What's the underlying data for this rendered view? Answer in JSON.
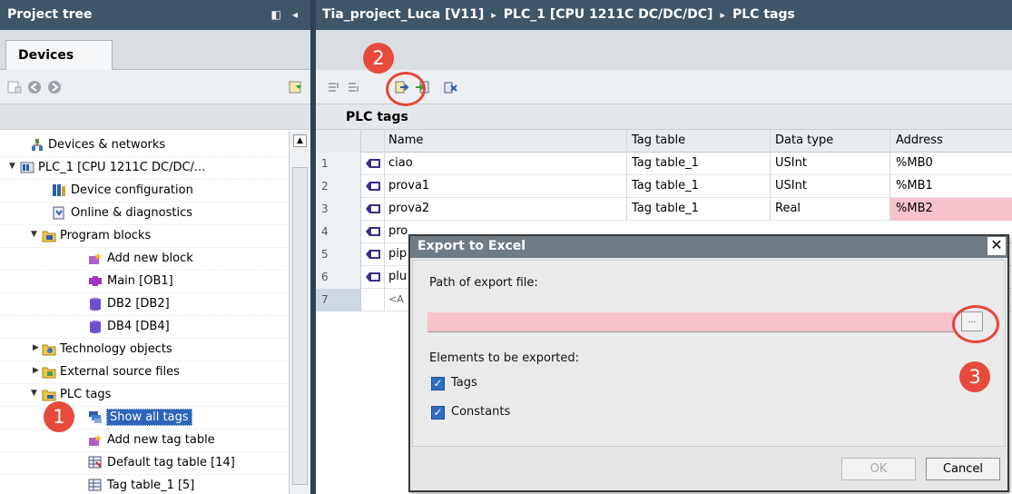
{
  "left": {
    "title": "Project tree",
    "window_controls": "◧ ◂",
    "devices_tab": "Devices"
  },
  "tree": {
    "items": [
      {
        "label": "Devices & networks"
      },
      {
        "label": "PLC_1 [CPU 1211C DC/DC/..."
      },
      {
        "label": "Device configuration"
      },
      {
        "label": "Online & diagnostics"
      },
      {
        "label": "Program blocks"
      },
      {
        "label": "Add new block"
      },
      {
        "label": "Main [OB1]"
      },
      {
        "label": "DB2 [DB2]"
      },
      {
        "label": "DB4 [DB4]"
      },
      {
        "label": "Technology objects"
      },
      {
        "label": "External source files"
      },
      {
        "label": "PLC tags"
      },
      {
        "label": "Show all tags"
      },
      {
        "label": "Add new tag table"
      },
      {
        "label": "Default tag table [14]"
      },
      {
        "label": "Tag table_1 [5]"
      }
    ]
  },
  "breadcrumb": {
    "project": "Tia_project_Luca [V11]",
    "device": "PLC_1 [CPU 1211C DC/DC/DC]",
    "section": "PLC tags",
    "separator": "▸"
  },
  "editor": {
    "title": "PLC tags",
    "columns": [
      "Name",
      "Tag table",
      "Data type",
      "Address"
    ],
    "rows": [
      {
        "n": "1",
        "name": "ciao",
        "table": "Tag table_1",
        "type": "USInt",
        "addr": "%MB0"
      },
      {
        "n": "2",
        "name": "prova1",
        "table": "Tag table_1",
        "type": "USInt",
        "addr": "%MB1"
      },
      {
        "n": "3",
        "name": "prova2",
        "table": "Tag table_1",
        "type": "Real",
        "addr": "%MB2"
      },
      {
        "n": "4",
        "name": "pro",
        "table": "",
        "type": "",
        "addr": ""
      },
      {
        "n": "5",
        "name": "pip",
        "table": "",
        "type": "",
        "addr": ""
      },
      {
        "n": "6",
        "name": "plu",
        "table": "",
        "type": "",
        "addr": ""
      },
      {
        "n": "7",
        "name": "<A",
        "table": "",
        "type": "",
        "addr": ""
      }
    ]
  },
  "dialog": {
    "title": "Export to Excel",
    "close": "✕",
    "path_label": "Path of export file:",
    "path_value": "",
    "browse": "...",
    "elements_label": "Elements to be exported:",
    "tags_label": "Tags",
    "constants_label": "Constants",
    "ok": "OK",
    "cancel": "Cancel"
  },
  "callouts": [
    "1",
    "2",
    "3"
  ],
  "colors": {
    "header_bar": "#3f5568",
    "selection": "#2d63b8",
    "error_pink": "#f6c3cc",
    "callout_red": "#e64a3c"
  }
}
